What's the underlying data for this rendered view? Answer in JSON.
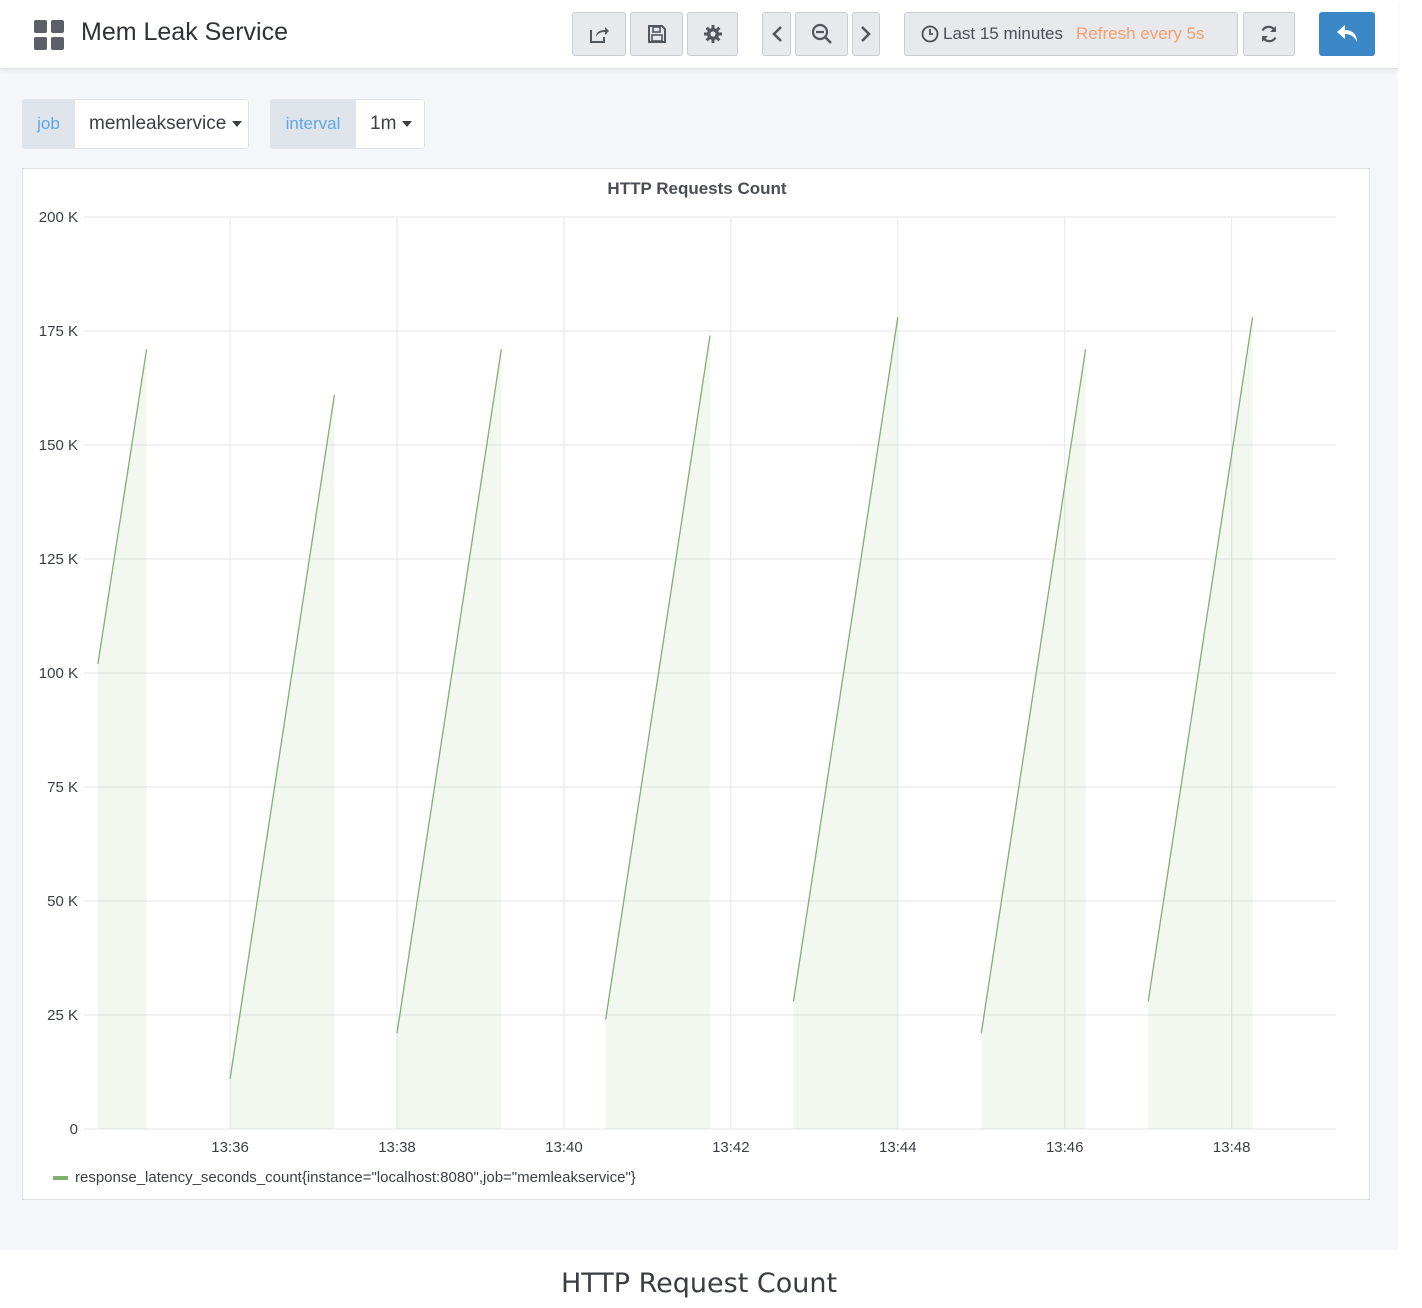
{
  "header": {
    "title": "Mem Leak Service",
    "icons": [
      "dashboard-grid-icon",
      "share-icon",
      "save-icon",
      "gear-icon",
      "chevron-left-icon",
      "zoom-out-icon",
      "chevron-right-icon",
      "clock-icon",
      "refresh-icon",
      "back-arrow-icon"
    ],
    "time_range": "Last 15 minutes",
    "refresh": "Refresh every 5s"
  },
  "variables": [
    {
      "label": "job",
      "value": "memleakservice"
    },
    {
      "label": "interval",
      "value": "1m"
    }
  ],
  "colors": {
    "series": "#7eb26d",
    "accent": "#3c87c8",
    "refresh_text": "#f59e6c",
    "variable_label": "#5fa9e0"
  },
  "chart_data": {
    "type": "area",
    "title": "HTTP Requests Count",
    "xlabel": "",
    "ylabel": "",
    "yticks": [
      "0",
      "25 K",
      "50 K",
      "75 K",
      "100 K",
      "125 K",
      "150 K",
      "175 K",
      "200 K"
    ],
    "xticks": [
      "13:36",
      "13:38",
      "13:40",
      "13:42",
      "13:44",
      "13:46",
      "13:48"
    ],
    "ylim": [
      0,
      200000
    ],
    "grid": true,
    "legend_placement": "bottom-left",
    "series": [
      {
        "name": "response_latency_seconds_count{instance=\"localhost:8080\",job=\"memleakservice\"}",
        "segments": [
          [
            [
              "13:34:25",
              102000
            ],
            [
              "13:35:00",
              171000
            ]
          ],
          [
            [
              "13:36:00",
              11000
            ],
            [
              "13:37:15",
              161000
            ]
          ],
          [
            [
              "13:38:00",
              21000
            ],
            [
              "13:39:15",
              171000
            ]
          ],
          [
            [
              "13:40:30",
              24000
            ],
            [
              "13:41:45",
              174000
            ]
          ],
          [
            [
              "13:42:45",
              28000
            ],
            [
              "13:44:00",
              178000
            ]
          ],
          [
            [
              "13:45:00",
              21000
            ],
            [
              "13:46:15",
              171000
            ]
          ],
          [
            [
              "13:47:00",
              28000
            ],
            [
              "13:48:15",
              178000
            ]
          ]
        ]
      }
    ]
  },
  "caption": "HTTP Request Count"
}
